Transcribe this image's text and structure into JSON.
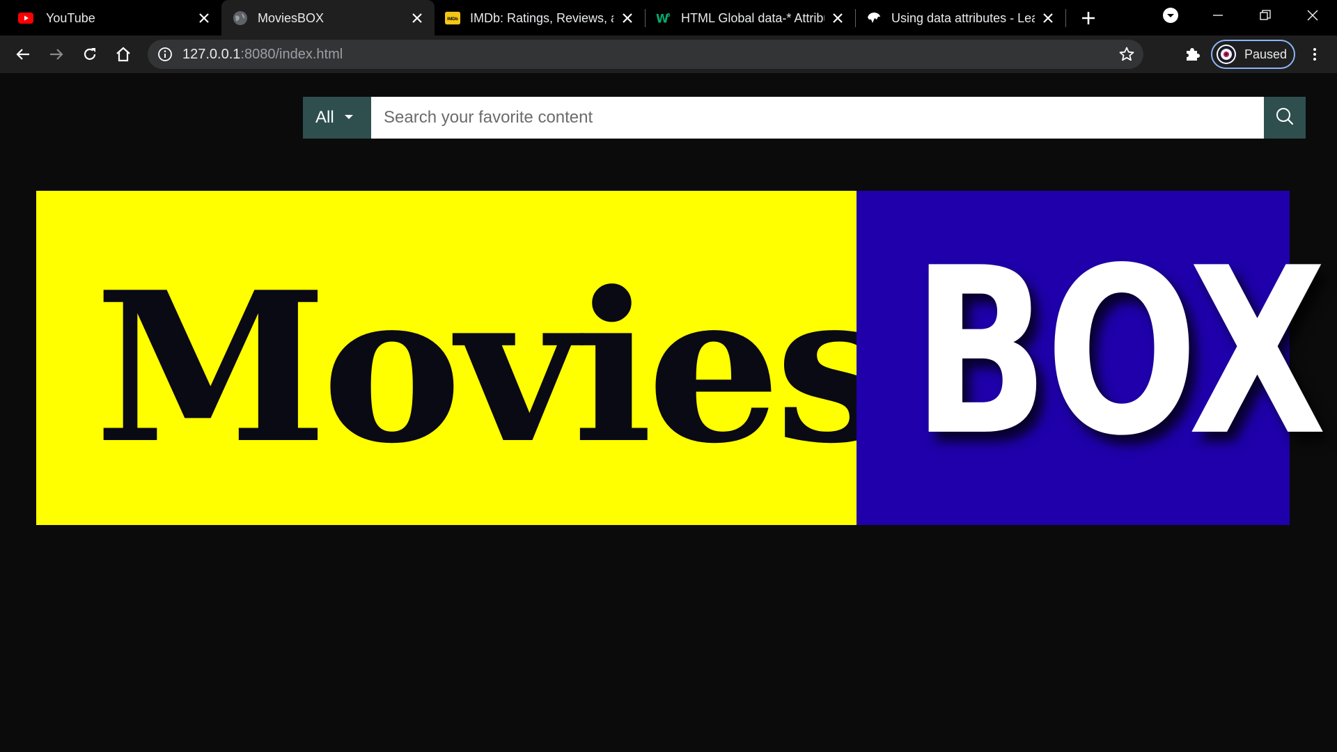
{
  "browser": {
    "tabs": [
      {
        "title": "YouTube",
        "favicon": "youtube-icon",
        "active": false
      },
      {
        "title": "MoviesBOX",
        "favicon": "globe-icon",
        "active": true
      },
      {
        "title": "IMDb: Ratings, Reviews, and Where to Watch",
        "favicon": "imdb-icon",
        "active": false
      },
      {
        "title": "HTML Global data-* Attributes",
        "favicon": "w3schools-icon",
        "active": false
      },
      {
        "title": "Using data attributes - Learn web development",
        "favicon": "mdn-icon",
        "active": false
      }
    ],
    "address": {
      "host": "127.0.0.1",
      "rest": ":8080/index.html"
    },
    "profile_label": "Paused"
  },
  "page": {
    "search": {
      "category_label": "All",
      "placeholder": "Search your favorite content"
    },
    "banner": {
      "left_text": "Movies",
      "right_text": "BOX",
      "left_bg": "#ffff00",
      "right_bg": "#1f00aa"
    },
    "accent_color": "#2f4f4f"
  }
}
